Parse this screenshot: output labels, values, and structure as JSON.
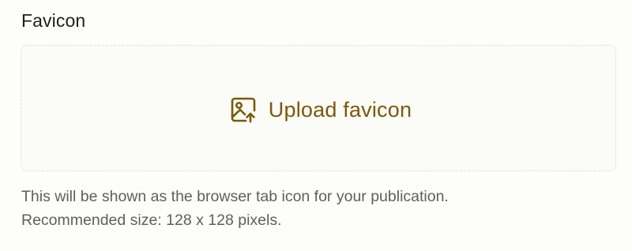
{
  "favicon_field": {
    "label": "Favicon",
    "upload_label": "Upload favicon",
    "upload_icon": "image-upload-icon",
    "help_line_1": "This will be shown as the browser tab icon for your publication.",
    "help_line_2": "Recommended size: 128 x 128 pixels."
  },
  "colors": {
    "accent": "#7a5a0a",
    "label_text": "#1f1f1f",
    "help_text": "#5f5f5f",
    "dropzone_border": "#e6e1c9",
    "background": "#fdfdfb"
  }
}
